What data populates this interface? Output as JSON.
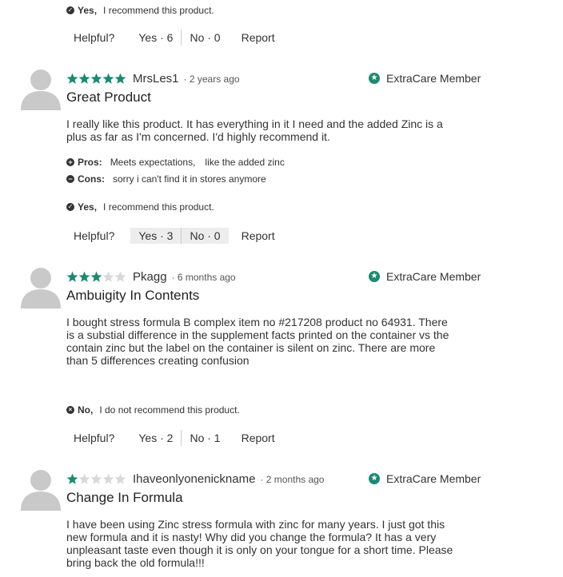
{
  "colors": {
    "accent": "#1a8a73",
    "star_empty": "#d8d8d8"
  },
  "top": {
    "recommend": {
      "icon": "check-circle-icon",
      "answer": "Yes,",
      "text": "I recommend this product."
    },
    "helpful": {
      "label": "Helpful?",
      "yes": "Yes · 6",
      "no": "No · 0",
      "report": "Report"
    }
  },
  "reviews": [
    {
      "rating": 5,
      "nickname": "MrsLes1",
      "age": "· 2 years ago",
      "badge": "ExtraCare Member",
      "title": "Great Product",
      "body": "I really like this product. It has everything in it I need and the added Zinc is a plus as far as I'm concerned. I'd highly recommend it.",
      "pros_label": "Pros:",
      "pros": [
        "Meets expectations,",
        "like the added zinc"
      ],
      "cons_label": "Cons:",
      "cons": [
        "sorry i can't find it in stores anymore"
      ],
      "recommend": {
        "answer": "Yes,",
        "text": "I recommend this product."
      },
      "helpful": {
        "label": "Helpful?",
        "yes": "Yes · 3",
        "no": "No · 0",
        "report": "Report"
      }
    },
    {
      "rating": 3,
      "nickname": "Pkagg",
      "age": "· 6 months ago",
      "badge": "ExtraCare Member",
      "title": "Ambuigity In Contents",
      "body": "I bought stress formula B complex item no #217208 product no 64931. There is a substial difference in the supplement facts printed on the container vs the contain zinc but the label on the container is silent on zinc. There are more than 5 differences creating confusion",
      "recommend": {
        "answer": "No,",
        "text": "I do not recommend this product."
      },
      "helpful": {
        "label": "Helpful?",
        "yes": "Yes · 2",
        "no": "No · 1",
        "report": "Report"
      }
    },
    {
      "rating": 1,
      "nickname": "Ihaveonlyonenickname",
      "age": "· 2 months ago",
      "badge": "ExtraCare Member",
      "title": "Change In Formula",
      "body": "I have been using Zinc stress formula with zinc for many years. I just got this new formula and it is nasty! Why did you change the formula? It has a very unpleasant taste even though it is only on your tongue for a short time. Please bring back the old formula!!!"
    }
  ]
}
